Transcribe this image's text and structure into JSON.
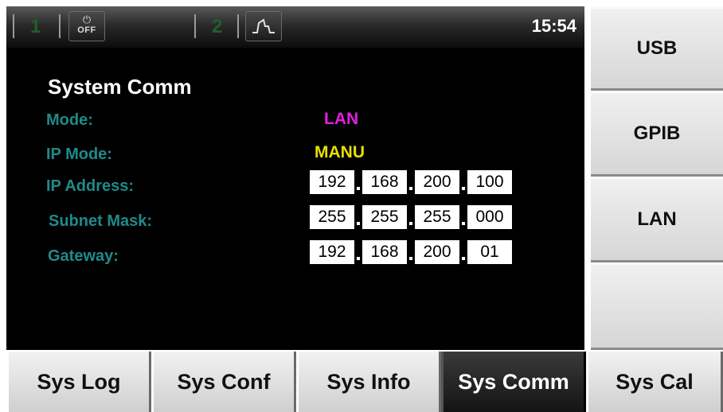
{
  "status_bar": {
    "channel1": "1",
    "power_label": "OFF",
    "channel2": "2",
    "time": "15:54"
  },
  "title": "System Comm",
  "fields": {
    "mode": {
      "label": "Mode:",
      "value": "LAN"
    },
    "ip_mode": {
      "label": "IP Mode:",
      "value": "MANU"
    },
    "ip_address": {
      "label": "IP Address:",
      "octets": [
        "192",
        "168",
        "200",
        "100"
      ]
    },
    "subnet_mask": {
      "label": "Subnet Mask:",
      "octets": [
        "255",
        "255",
        "255",
        "000"
      ]
    },
    "gateway": {
      "label": "Gateway:",
      "octets": [
        "192",
        "168",
        "200",
        "01"
      ]
    }
  },
  "softkeys": [
    "USB",
    "GPIB",
    "LAN",
    ""
  ],
  "tabs": [
    "Sys Log",
    "Sys Conf",
    "Sys Info",
    "Sys Comm",
    "Sys Cal"
  ],
  "active_tab": "Sys Comm",
  "colors": {
    "label": "#1f8a8a",
    "mode_value": "#e020e0",
    "ip_mode_value": "#e8e000",
    "screen_bg": "#000000"
  },
  "icons": {
    "power": "power-icon",
    "waveform": "pulse-waveform-icon"
  }
}
